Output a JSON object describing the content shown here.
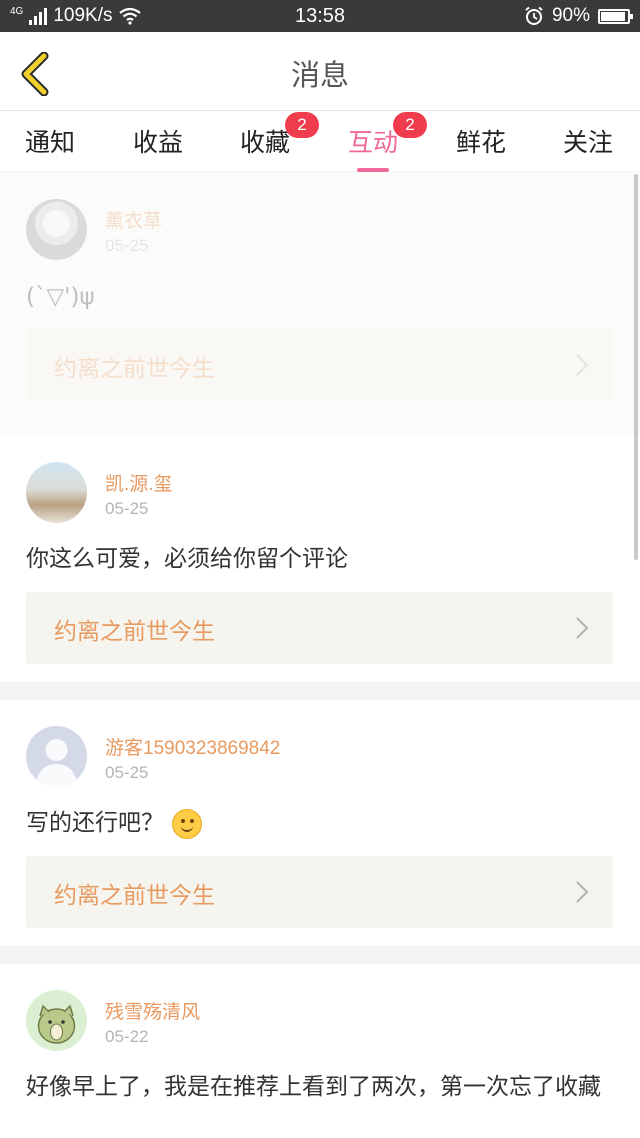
{
  "status_bar": {
    "network": "4G",
    "speed": "109K/s",
    "time": "13:58",
    "battery": "90%"
  },
  "header": {
    "title": "消息"
  },
  "tabs": [
    {
      "label": "通知",
      "badge": ""
    },
    {
      "label": "收益",
      "badge": ""
    },
    {
      "label": "收藏",
      "badge": "2"
    },
    {
      "label": "互动",
      "badge": "2",
      "active": true
    },
    {
      "label": "鲜花",
      "badge": ""
    },
    {
      "label": "关注",
      "badge": ""
    }
  ],
  "comments": [
    {
      "user": "薰衣草",
      "date": "05-25",
      "text": "(`▽')ψ",
      "work": "约离之前世今生"
    },
    {
      "user": "凯.源.玺",
      "date": "05-25",
      "text": "你这么可爱，必须给你留个评论",
      "work": "约离之前世今生"
    },
    {
      "user": "游客1590323869842",
      "date": "05-25",
      "text": "写的还行吧？",
      "work": "约离之前世今生"
    },
    {
      "user": "残雪殇清风",
      "date": "05-22",
      "text": "好像早上了，我是在推荐上看到了两次，第一次忘了收藏",
      "work": ""
    }
  ],
  "colors": {
    "accent": "#f0679a",
    "badge": "#f03d4d",
    "username": "#e89a60",
    "back_arrow": "#f2cf2c"
  }
}
